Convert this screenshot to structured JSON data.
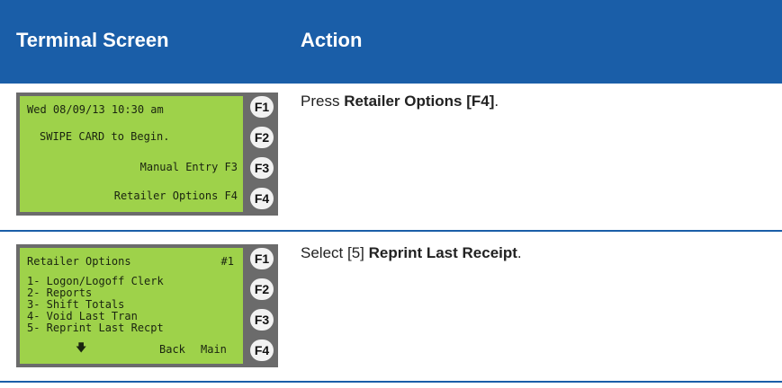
{
  "header": {
    "col_screen": "Terminal Screen",
    "col_action": "Action"
  },
  "rows": [
    {
      "lcd": {
        "line1_left": "Wed 08/09/13 10:30 am",
        "line2": "SWIPE CARD to Begin.",
        "line3": "Manual Entry F3",
        "line4": "Retailer Options F4"
      },
      "fkeys": [
        "F1",
        "F2",
        "F3",
        "F4"
      ],
      "action": {
        "prefix": "Press ",
        "bold": "Retailer Options [F4]",
        "suffix": "."
      }
    },
    {
      "lcd": {
        "title": "Retailer Options",
        "title_right": "#1",
        "items": [
          "1- Logon/Logoff Clerk",
          "2- Reports",
          "3- Shift Totals",
          "4- Void Last Tran",
          "5- Reprint Last Recpt"
        ],
        "arrow": "🡇",
        "back": "Back",
        "main": "Main"
      },
      "fkeys": [
        "F1",
        "F2",
        "F3",
        "F4"
      ],
      "action": {
        "prefix": "Select [5] ",
        "bold": "Reprint Last Receipt",
        "suffix": "."
      }
    }
  ],
  "colors": {
    "header_bg": "#1a5ea8",
    "lcd_bg": "#9ed24a",
    "frame": "#6b6b6b"
  }
}
